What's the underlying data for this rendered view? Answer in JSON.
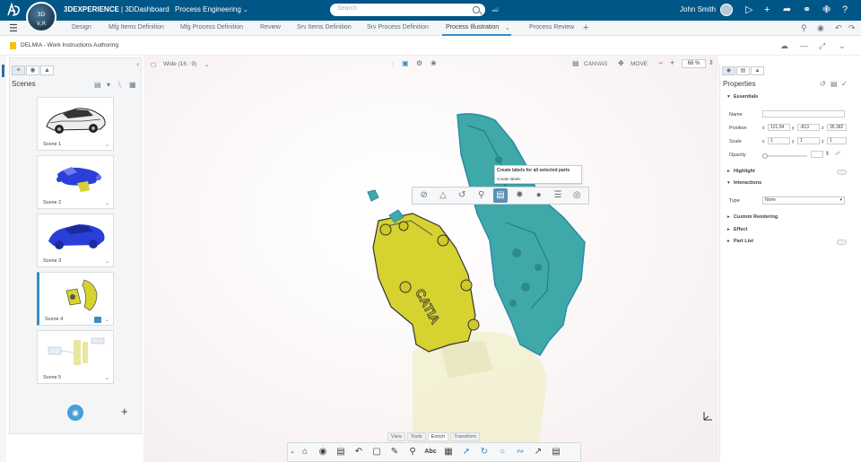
{
  "topbar": {
    "compass_top": "3D",
    "compass_bottom": "V,R",
    "brand_prefix": "3D",
    "brand_bold": "EXPERIENCE",
    "brand_suffix": " | 3DDashboard",
    "app_name": "Process Engineering",
    "search_placeholder": "Search",
    "user_name": "John Smith"
  },
  "tabs": [
    {
      "label": "Design"
    },
    {
      "label": "Mfg Items Definition"
    },
    {
      "label": "Mfg Process Definition"
    },
    {
      "label": "Review"
    },
    {
      "label": "Srv Items Definition"
    },
    {
      "label": "Srv Process Definition"
    },
    {
      "label": "Process Illustration",
      "active": true
    },
    {
      "label": "Process Review"
    }
  ],
  "document": {
    "title": "DELMIA - Work Instructions Authoring"
  },
  "scenes_panel": {
    "title": "Scenes",
    "scenes": [
      {
        "label": "Scene 1"
      },
      {
        "label": "Scene 2"
      },
      {
        "label": "Scene 3"
      },
      {
        "label": "Scene 4",
        "active": true
      },
      {
        "label": "Scene 5"
      }
    ]
  },
  "viewport": {
    "aspect_label": "Wide (16 : 9)",
    "canvas_label": "CANVAS",
    "move_label": "MOVE",
    "zoom": "68 %",
    "part_text": "CATIA"
  },
  "context_toolbar": {
    "tooltip_title": "Create labels for all selected parts",
    "tooltip_subtitle": "Create labels",
    "buttons": [
      "hide-icon",
      "prism-icon",
      "reframe-icon",
      "zoom-icon",
      "label-icon",
      "explode-icon",
      "sphere-icon",
      "list-icon",
      "globe-icon"
    ],
    "selected_index": 4
  },
  "bottom_toolbar": {
    "tabs": [
      {
        "label": "View"
      },
      {
        "label": "Tools"
      },
      {
        "label": "Enrich",
        "active": true
      },
      {
        "label": "Transform"
      }
    ],
    "text_tool": "Abc"
  },
  "properties": {
    "title": "Properties",
    "essentials": "Essentials",
    "name_label": "Name",
    "name_value": "",
    "position_label": "Position",
    "position": {
      "x": "121.94",
      "y": "-813",
      "z": "35.382"
    },
    "scale_label": "Scale",
    "scale": {
      "x": "1",
      "y": "1",
      "z": "1"
    },
    "opacity_label": "Opacity",
    "opacity_value": "",
    "highlight": "Highlight",
    "interactions": "Interactions",
    "type_label": "Type",
    "type_value": "None",
    "custom_rendering": "Custom Rendering",
    "effect": "Effect",
    "part_list": "Part List",
    "axis_x": "x",
    "axis_y": "y",
    "axis_z": "z"
  },
  "colors": {
    "topbar": "#005686",
    "accent": "#368ec4",
    "part_teal": "#3fa9a9",
    "part_yellow": "#d6d230",
    "scene_blue": "#2a3ed8"
  }
}
